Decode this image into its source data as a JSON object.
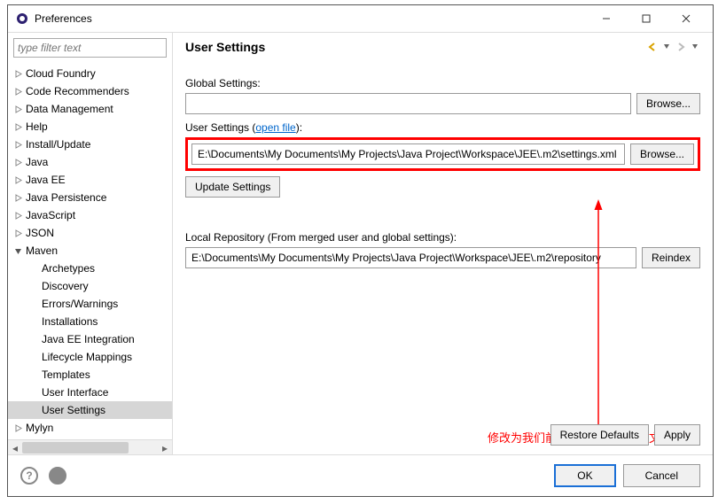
{
  "window": {
    "title": "Preferences"
  },
  "filter": {
    "placeholder": "type filter text"
  },
  "tree": [
    {
      "label": "Cloud Foundry",
      "depth": 0,
      "expanded": false,
      "hasChildren": true
    },
    {
      "label": "Code Recommenders",
      "depth": 0,
      "expanded": false,
      "hasChildren": true
    },
    {
      "label": "Data Management",
      "depth": 0,
      "expanded": false,
      "hasChildren": true
    },
    {
      "label": "Help",
      "depth": 0,
      "expanded": false,
      "hasChildren": true
    },
    {
      "label": "Install/Update",
      "depth": 0,
      "expanded": false,
      "hasChildren": true
    },
    {
      "label": "Java",
      "depth": 0,
      "expanded": false,
      "hasChildren": true
    },
    {
      "label": "Java EE",
      "depth": 0,
      "expanded": false,
      "hasChildren": true
    },
    {
      "label": "Java Persistence",
      "depth": 0,
      "expanded": false,
      "hasChildren": true
    },
    {
      "label": "JavaScript",
      "depth": 0,
      "expanded": false,
      "hasChildren": true
    },
    {
      "label": "JSON",
      "depth": 0,
      "expanded": false,
      "hasChildren": true
    },
    {
      "label": "Maven",
      "depth": 0,
      "expanded": true,
      "hasChildren": true
    },
    {
      "label": "Archetypes",
      "depth": 1,
      "hasChildren": false
    },
    {
      "label": "Discovery",
      "depth": 1,
      "hasChildren": false
    },
    {
      "label": "Errors/Warnings",
      "depth": 1,
      "hasChildren": false
    },
    {
      "label": "Installations",
      "depth": 1,
      "hasChildren": false
    },
    {
      "label": "Java EE Integration",
      "depth": 1,
      "hasChildren": false
    },
    {
      "label": "Lifecycle Mappings",
      "depth": 1,
      "hasChildren": false
    },
    {
      "label": "Templates",
      "depth": 1,
      "hasChildren": false
    },
    {
      "label": "User Interface",
      "depth": 1,
      "hasChildren": false
    },
    {
      "label": "User Settings",
      "depth": 1,
      "hasChildren": false,
      "selected": true
    },
    {
      "label": "Mylyn",
      "depth": 0,
      "expanded": false,
      "hasChildren": true
    }
  ],
  "page": {
    "heading": "User Settings",
    "globalSettingsLabel": "Global Settings:",
    "globalSettingsValue": "",
    "browseLabel": "Browse...",
    "userSettingsLabelPrefix": "User Settings (",
    "userSettingsLink": "open file",
    "userSettingsLabelSuffix": "):",
    "userSettingsValue": "E:\\Documents\\My Documents\\My Projects\\Java Project\\Workspace\\JEE\\.m2\\settings.xml",
    "updateSettingsLabel": "Update Settings",
    "localRepoLabel": "Local Repository (From merged user and global settings):",
    "localRepoValue": "E:\\Documents\\My Documents\\My Projects\\Java Project\\Workspace\\JEE\\.m2\\repository",
    "reindexLabel": "Reindex",
    "restoreDefaultsLabel": "Restore Defaults",
    "applyLabel": "Apply"
  },
  "footer": {
    "okLabel": "OK",
    "cancelLabel": "Cancel"
  },
  "annotation": {
    "text": "修改为我们前面复制出来的配置文件路径"
  }
}
